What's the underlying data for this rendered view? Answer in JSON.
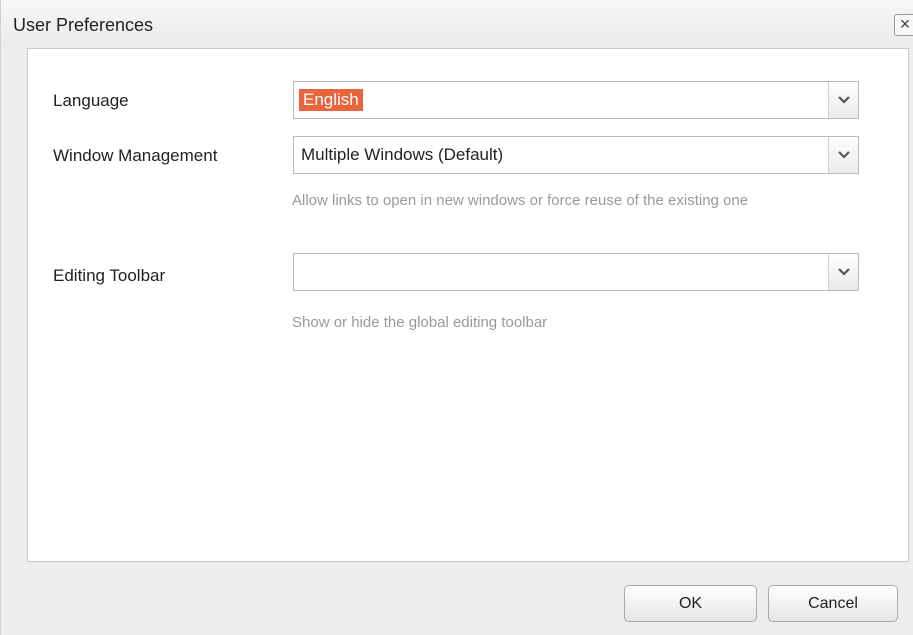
{
  "dialog": {
    "title": "User Preferences",
    "close_glyph": "×"
  },
  "fields": {
    "language": {
      "label": "Language",
      "value": "English",
      "icon": "chevron-down-icon"
    },
    "window_management": {
      "label": "Window Management",
      "value": "Multiple Windows (Default)",
      "help": "Allow links to open in new windows or force reuse of the existing one",
      "icon": "chevron-down-icon"
    },
    "editing_toolbar": {
      "label": "Editing Toolbar",
      "value": "",
      "help": "Show or hide the global editing toolbar",
      "icon": "chevron-down-icon"
    }
  },
  "buttons": {
    "ok": "OK",
    "cancel": "Cancel"
  },
  "colors": {
    "selection_highlight": "#e8643c",
    "help_text": "#9a9a9a"
  }
}
